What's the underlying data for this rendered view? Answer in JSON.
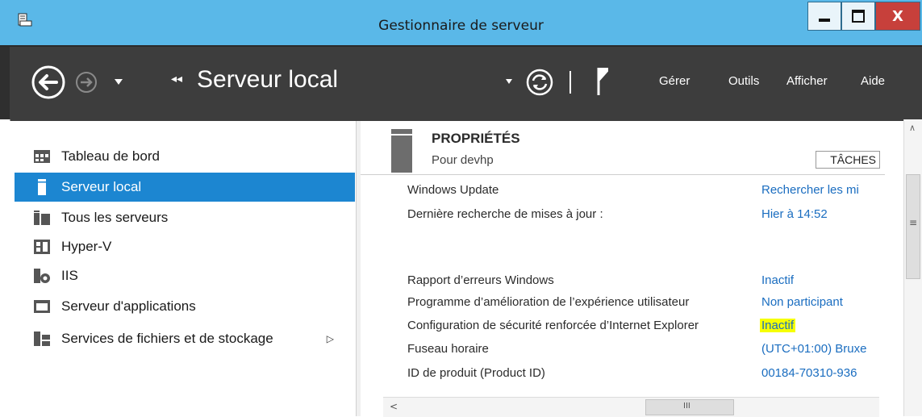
{
  "window": {
    "title": "Gestionnaire de serveur",
    "min_glyph": "▁",
    "max_glyph": "□",
    "close_glyph": "X"
  },
  "toolbar": {
    "breadcrumb_arrows": "◂◂",
    "page_title": "Serveur local",
    "menu": [
      "Gérer",
      "Outils",
      "Afficher",
      "Aide"
    ]
  },
  "sidebar": {
    "items": [
      {
        "label": "Tableau de bord",
        "icon": "dashboard-icon"
      },
      {
        "label": "Serveur local",
        "icon": "local-server-icon",
        "active": true
      },
      {
        "label": "Tous les serveurs",
        "icon": "all-servers-icon"
      },
      {
        "label": "Hyper-V",
        "icon": "hyperv-icon"
      },
      {
        "label": "IIS",
        "icon": "iis-icon"
      },
      {
        "label": "Serveur d'applications",
        "icon": "app-server-icon"
      },
      {
        "label": "Services de fichiers et de stockage",
        "icon": "file-storage-icon",
        "expandable": true
      }
    ],
    "expand_glyph": "▷"
  },
  "properties": {
    "title": "PROPRIÉTÉS",
    "subtitle": "Pour devhp",
    "tasks_label": "TÂCHES",
    "rows": [
      {
        "label": "Windows Update",
        "value": "Rechercher les mi"
      },
      {
        "label": "Dernière recherche de mises à jour :",
        "value": "Hier à 14:52"
      },
      {
        "label": "Rapport d’erreurs Windows",
        "value": "Inactif"
      },
      {
        "label": "Programme d’amélioration de l’expérience utilisateur",
        "value": "Non participant"
      },
      {
        "label": "Configuration de sécurité renforcée d’Internet Explorer",
        "value": "Inactif",
        "highlight": true
      },
      {
        "label": "Fuseau horaire",
        "value": "(UTC+01:00) Bruxe"
      },
      {
        "label": "ID de produit (Product ID)",
        "value": "00184-70310-936"
      }
    ]
  },
  "scroll": {
    "up_glyph": "∧",
    "left_glyph": "<",
    "v_grip": "≡",
    "h_grip": "III"
  },
  "colors": {
    "titlebar": "#5ab8e8",
    "toolbar": "#3d3d3d",
    "active_item": "#1c86d1",
    "link": "#1a6dc0",
    "highlight": "#f6ff00",
    "close_button": "#c7403b"
  }
}
